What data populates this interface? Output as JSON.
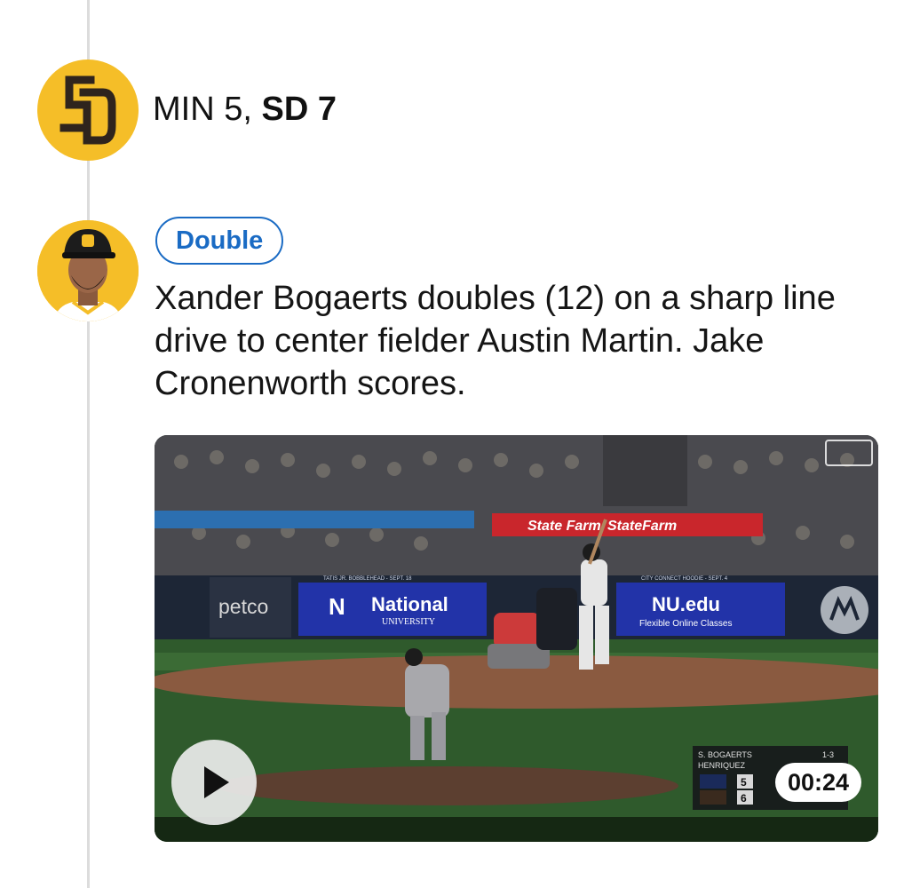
{
  "score": {
    "away_label": "MIN 5,",
    "home_label": "SD 7"
  },
  "play": {
    "badge": "Double",
    "description": "Xander Bogaerts doubles (12) on a sharp line drive to center fielder Austin Martin. Jake Cronenworth scores."
  },
  "video": {
    "duration": "00:24",
    "signage": {
      "left_sign": "petco",
      "national_title": "National",
      "national_sub": "UNIVERSITY",
      "nu_title": "NU.edu",
      "nu_sub": "Flexible Online Classes",
      "state_farm": "State Farm",
      "tatis_promo": "TATIS JR. BOBBLEHEAD - SEPT. 18",
      "connect_promo": "CITY CONNECT HOODIE - SEPT. 4"
    },
    "scorebug": {
      "batter": "S. BOGAERTS",
      "batter_stat": "1-3",
      "pitcher": "HENRIQUEZ",
      "away_score": "5",
      "home_score": "6"
    }
  },
  "colors": {
    "padres_gold": "#F5BE28",
    "padres_brown": "#2F241D",
    "badge_blue": "#1a6bc4"
  },
  "icons": {
    "team_logo": "sd-logo-icon",
    "play": "play-icon"
  }
}
